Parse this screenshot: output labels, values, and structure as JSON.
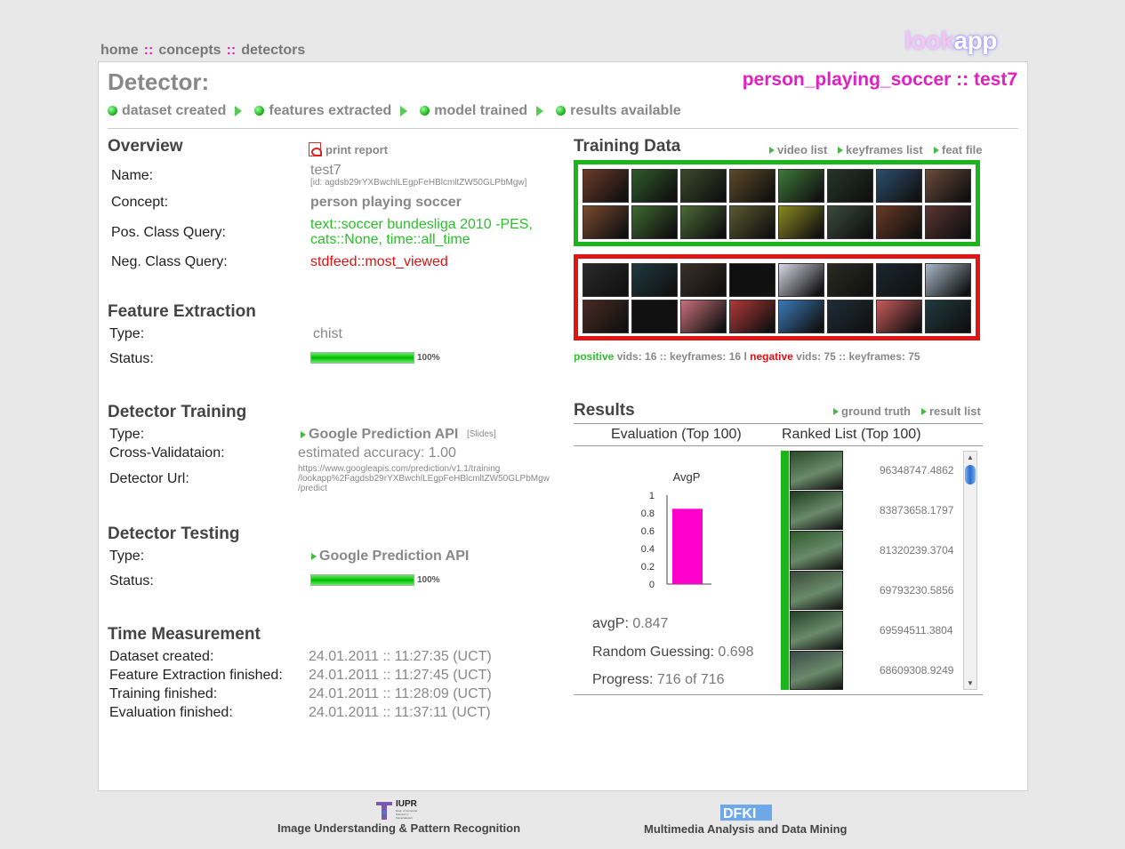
{
  "nav": {
    "home": "home",
    "concepts": "concepts",
    "detectors": "detectors",
    "sep": "::"
  },
  "logo": {
    "part1": "look",
    "part2": "app"
  },
  "header": {
    "title": "Detector:",
    "detector_name": "person_playing_soccer :: test7",
    "steps": [
      "dataset created",
      "features extracted",
      "model trained",
      "results available"
    ]
  },
  "overview": {
    "heading": "Overview",
    "print_report": "print report",
    "rows": {
      "name_label": "Name:",
      "name_value": "test7",
      "name_id": "[id: agdsb29rYXBwchlLEgpFeHBlcmltZW50GLPbMgw]",
      "concept_label": "Concept:",
      "concept_value": "person playing soccer",
      "pos_label": "Pos. Class Query:",
      "pos_value_1": "text::soccer bundesliga 2010 -PES,",
      "pos_value_2": "cats::None, time::all_time",
      "neg_label": "Neg. Class Query:",
      "neg_value": "stdfeed::most_viewed"
    }
  },
  "feature_extraction": {
    "heading": "Feature Extraction",
    "type_label": "Type:",
    "type_value": "chist",
    "status_label": "Status:",
    "status_percent": "100%",
    "progress": 1.0
  },
  "detector_training": {
    "heading": "Detector Training",
    "type_label": "Type:",
    "type_value": "Google Prediction API",
    "slides": "[Slides]",
    "cv_label": "Cross-Validataion:",
    "cv_value": "estimated accuracy: 1.00",
    "url_label": "Detector Url:",
    "url_1": "https://www.googleapis.com/prediction/v1.1/training",
    "url_2": "/lookapp%2Fagdsb29rYXBwchlLEgpFeHBlcmltZW50GLPbMgw",
    "url_3": "/predict"
  },
  "detector_testing": {
    "heading": "Detector Testing",
    "type_label": "Type:",
    "type_value": "Google Prediction API",
    "status_label": "Status:",
    "status_percent": "100%",
    "progress": 1.0
  },
  "time_measurement": {
    "heading": "Time Measurement",
    "rows": [
      {
        "label": "Dataset created:",
        "value": "24.01.2011 :: 11:27:35 (UCT)"
      },
      {
        "label": "Feature Extraction finished:",
        "value": "24.01.2011 :: 11:27:45 (UCT)"
      },
      {
        "label": "Training finished:",
        "value": "24.01.2011 :: 11:28:09 (UCT)"
      },
      {
        "label": "Evaluation finished:",
        "value": "24.01.2011 :: 11:37:11 (UCT)"
      }
    ]
  },
  "training_data": {
    "heading": "Training Data",
    "links": [
      "video list",
      "keyframes list",
      "feat file"
    ],
    "positive_colors": [
      "#6b3a2a",
      "#2e5a2a",
      "#3a4a2c",
      "#5d4a28",
      "#3f7a3a",
      "#24352a",
      "#2c4e6e",
      "#6a4a3a",
      "#7a4a2e",
      "#3e6a30",
      "#4a6a36",
      "#5a5a30",
      "#8a8a20",
      "#3a4a3e",
      "#6a3a26",
      "#5a3430"
    ],
    "negative_colors": [
      "#2a2a2a",
      "#1e3a40",
      "#3a3026",
      "#0e0e0e",
      "#d8d8e8",
      "#2a2a22",
      "#1a2630",
      "#a8b8c8",
      "#4a2a22",
      "#111111",
      "#c8707a",
      "#b03838",
      "#3a7ab8",
      "#1e2e38",
      "#c85a5a",
      "#203a3e"
    ],
    "stats": {
      "positive": "positive",
      "pos_text": "vids: 16 :: keyframes: 16 l",
      "negative": "negative",
      "neg_text": "vids: 75 :: keyframes: 75"
    }
  },
  "results": {
    "heading": "Results",
    "links": [
      "ground truth",
      "result list"
    ],
    "tab_eval": "Evaluation (Top 100)",
    "tab_ranked": "Ranked List (Top 100)",
    "avgp_label": "avgP:",
    "avgp_value": "0.847",
    "random_label": "Random Guessing:",
    "random_value": "0.698",
    "progress_label": "Progress:",
    "progress_value": "716 of 716",
    "scores": [
      "96348747.4862",
      "83873658.1797",
      "81320239.3704",
      "69793230.5856",
      "69594511.3804",
      "68609308.9249"
    ],
    "thumb_colors": [
      "#2a4a2a",
      "#1e3a1e",
      "#2c5a2a",
      "#3a4a3a",
      "#24402a",
      "#3a4a4a"
    ]
  },
  "chart_data": {
    "type": "bar",
    "title": "AvgP",
    "categories": [
      ""
    ],
    "values": [
      0.847
    ],
    "ylim": [
      0,
      1
    ],
    "yticks": [
      "1",
      "0.8",
      "0.6",
      "0.4",
      "0.2",
      "0"
    ],
    "color": "#ff00cc"
  },
  "footer": {
    "iupr_logo": "IUPR",
    "iupr_sub": "Dept. of Computer Science U. Kaiserslautern",
    "iupr_text": "Image Understanding & Pattern Recognition",
    "dfki_text": "Multimedia Analysis and Data Mining"
  }
}
